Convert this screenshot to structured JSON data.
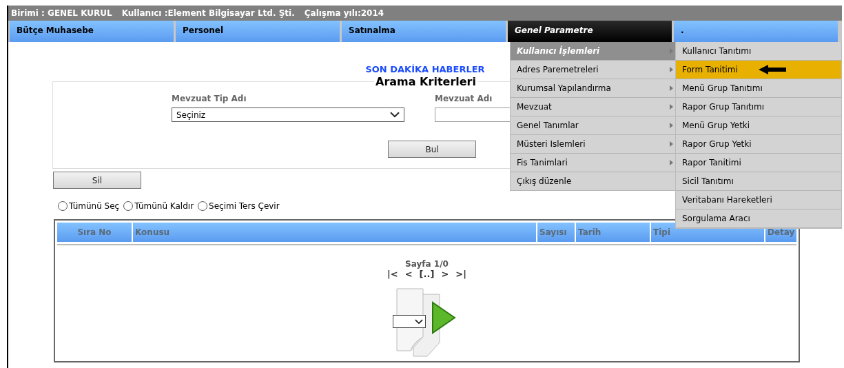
{
  "status_bar": {
    "unit": "Birimi : GENEL KURUL",
    "user": "Kullanıcı :Element Bilgisayar Ltd. Şti.",
    "year": "Çalışma yılı:2014"
  },
  "nav": [
    {
      "label": "Bütçe Muhasebe",
      "selected": false
    },
    {
      "label": "Personel",
      "selected": false
    },
    {
      "label": "Satınalma",
      "selected": false
    },
    {
      "label": "Genel Parametre",
      "selected": true
    },
    {
      "label": ".",
      "selected": false
    }
  ],
  "menu": {
    "items": [
      {
        "label": "Kullanıcı İşlemleri",
        "selected": true,
        "has_submenu": true
      },
      {
        "label": "Adres Paremetreleri",
        "selected": false,
        "has_submenu": true
      },
      {
        "label": "Kurumsal Yapılandırma",
        "selected": false,
        "has_submenu": true
      },
      {
        "label": "Mevzuat",
        "selected": false,
        "has_submenu": true
      },
      {
        "label": "Genel Tanımlar",
        "selected": false,
        "has_submenu": true
      },
      {
        "label": "Müsteri Islemleri",
        "selected": false,
        "has_submenu": true
      },
      {
        "label": "Fis Tanimlari",
        "selected": false,
        "has_submenu": true
      },
      {
        "label": "Çıkış düzenle",
        "selected": false,
        "has_submenu": false
      }
    ]
  },
  "submenu": {
    "items": [
      {
        "label": "Kullanıcı Tanıtımı",
        "selected": false
      },
      {
        "label": "Form Tanitimi",
        "selected": true
      },
      {
        "label": "Menü Grup Tanıtımı",
        "selected": false
      },
      {
        "label": "Rapor Grup Tanıtımı",
        "selected": false
      },
      {
        "label": "Menü Grup Yetki",
        "selected": false
      },
      {
        "label": "Rapor Grup Yetki",
        "selected": false
      },
      {
        "label": "Rapor Tanitimi",
        "selected": false
      },
      {
        "label": "Sicil Tanıtımı",
        "selected": false
      },
      {
        "label": "Veritabanı Hareketleri",
        "selected": false
      },
      {
        "label": "Sorgulama Aracı",
        "selected": false
      }
    ]
  },
  "news_title": "SON DAKİKA HABERLER",
  "search": {
    "legend": "Arama Kriterleri",
    "fields": [
      {
        "label": "Mevzuat Tip Adı",
        "kind": "select",
        "value": "Seçiniz"
      },
      {
        "label": "Mevzuat Adı",
        "kind": "text"
      }
    ],
    "submit": "Bul"
  },
  "delete_button": "Sil",
  "selection_options": [
    {
      "label": "Tümünü Seç",
      "selected": false
    },
    {
      "label": "Tümünü Kaldır",
      "selected": false
    },
    {
      "label": "Seçimi Ters Çevir",
      "selected": false
    }
  ],
  "table": {
    "columns": [
      "Sıra No",
      "Konusu",
      "Sayısı",
      "Tarih",
      "Tipi",
      "Detay"
    ],
    "pager": {
      "page": "Sayfa 1/0",
      "controls": [
        "|<",
        "<",
        "[..]",
        ">",
        ">|"
      ]
    }
  }
}
